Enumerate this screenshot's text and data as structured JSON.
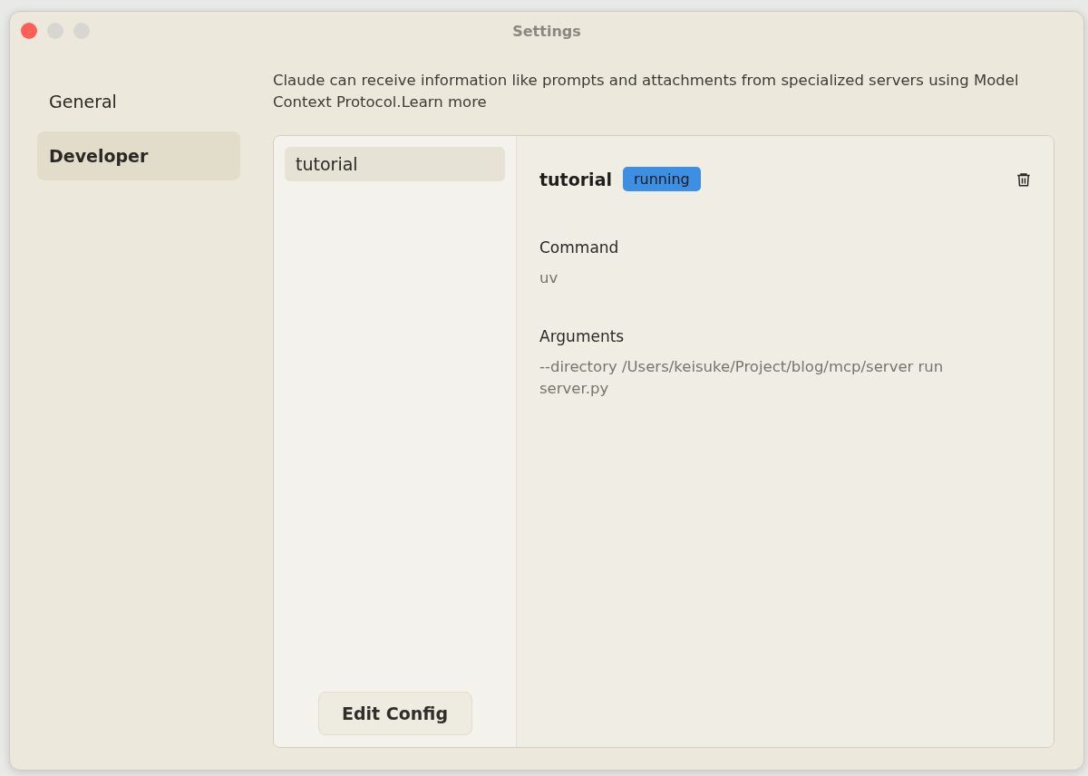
{
  "window": {
    "title": "Settings"
  },
  "sidebar": {
    "items": [
      {
        "label": "General",
        "selected": false
      },
      {
        "label": "Developer",
        "selected": true
      }
    ]
  },
  "intro": {
    "text": "Claude can receive information like prompts and attachments from specialized servers using Model Context Protocol.",
    "link": "Learn more"
  },
  "servers": [
    {
      "name": "tutorial",
      "selected": true
    }
  ],
  "edit_button": "Edit Config",
  "detail": {
    "name": "tutorial",
    "status": {
      "label": "running",
      "kind": "running"
    },
    "fields": [
      {
        "label": "Command",
        "value": "uv"
      },
      {
        "label": "Arguments",
        "value": "--directory /Users/keisuke/Project/blog/mcp/server run server.py"
      }
    ]
  }
}
